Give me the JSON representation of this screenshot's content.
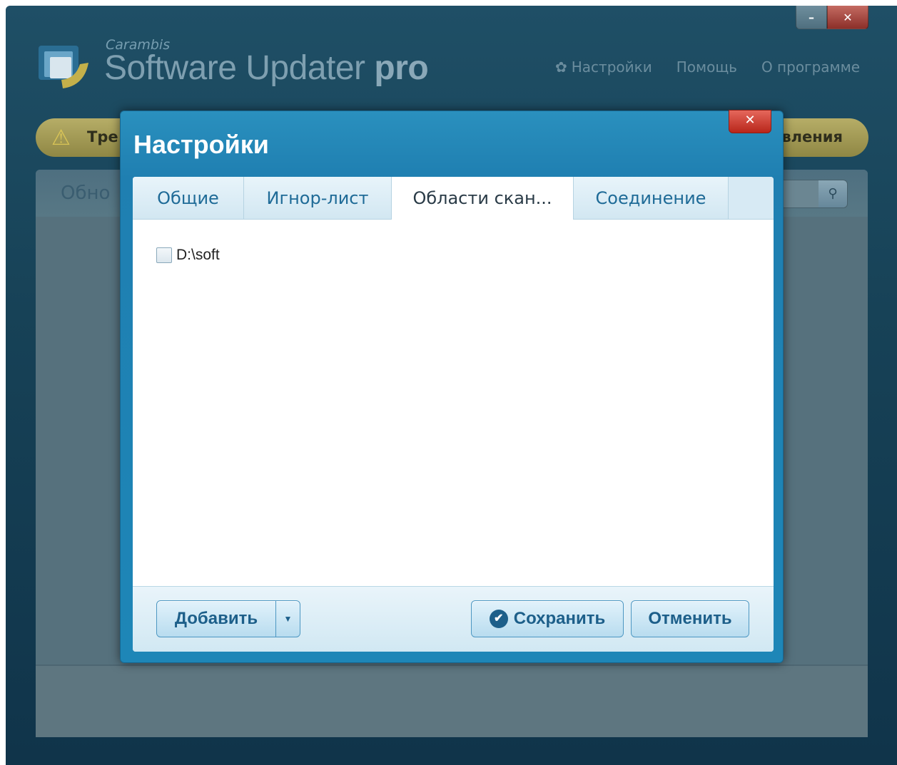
{
  "app": {
    "brand_small": "Carambis",
    "brand_main": "Software Updater",
    "brand_suffix": "pro",
    "nav": {
      "settings": "Настройки",
      "help": "Помощь",
      "about": "О программе"
    },
    "alert_left": "Тре",
    "alert_right": "вления",
    "panel_title": "Обно"
  },
  "dialog": {
    "title": "Настройки",
    "close_glyph": "✕",
    "tabs": [
      {
        "label": "Общие"
      },
      {
        "label": "Игнор-лист"
      },
      {
        "label": "Области скан..."
      },
      {
        "label": "Соединение"
      }
    ],
    "active_tab": 2,
    "scan_areas": [
      {
        "path": "D:\\soft",
        "checked": false
      }
    ],
    "buttons": {
      "add": "Добавить",
      "save": "Сохранить",
      "cancel": "Отменить"
    }
  },
  "colors": {
    "dialog_blue": "#1f7fb1",
    "button_text": "#1d5f8a",
    "close_red": "#c9342a"
  }
}
